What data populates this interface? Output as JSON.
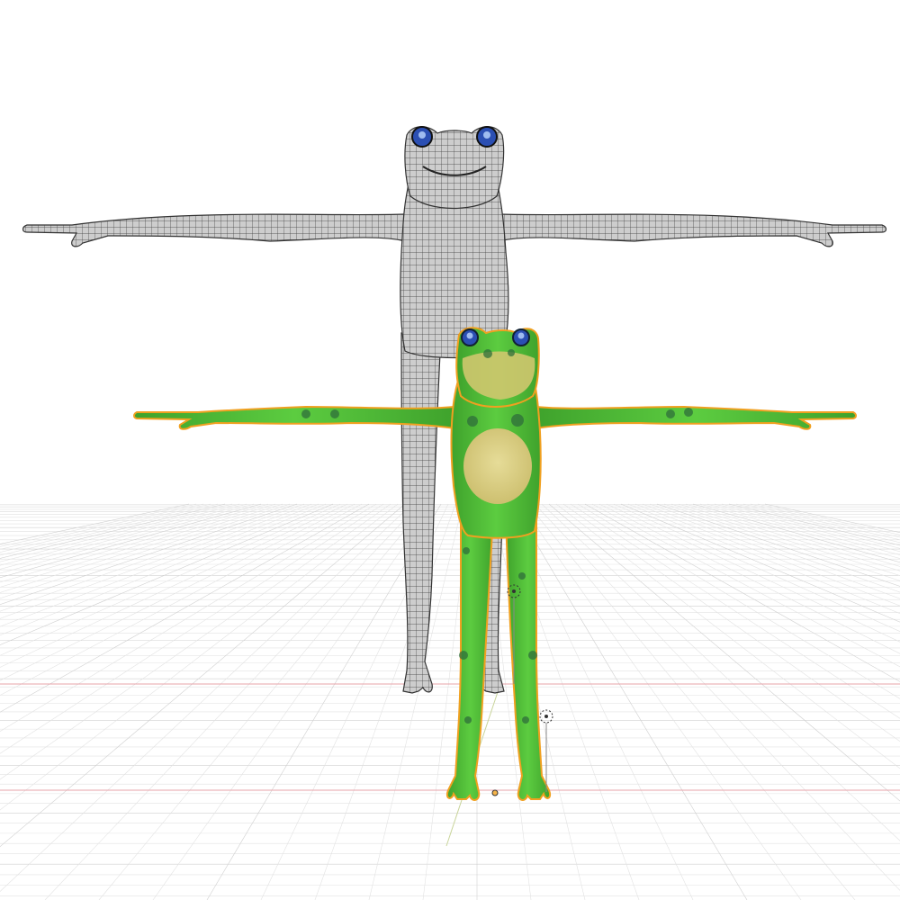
{
  "viewport": {
    "background": "#ffffff",
    "grid_color": "#e2e2e2",
    "grid_major_color": "#d0d0d0",
    "x_axis_color": "#e7a3aa",
    "y_axis_color": "#c9d49a"
  },
  "objects": [
    {
      "name": "frog-wireframe",
      "display": "wireframe",
      "base_color": "#c9c9c9",
      "wire_color": "#3c3c3c",
      "eye_color": "#2b4fb3",
      "selected": false
    },
    {
      "name": "frog-textured",
      "display": "solid-textured",
      "body_color": "#4cbc36",
      "belly_color": "#d9cd84",
      "spot_color": "#2f6e3b",
      "outline_color": "#f0a020",
      "eye_color": "#2b4fb3",
      "selected": true
    }
  ],
  "helpers": [
    {
      "name": "light-empty-1",
      "icon": "light-icon"
    },
    {
      "name": "light-empty-2",
      "icon": "light-icon"
    },
    {
      "name": "object-origin",
      "icon": "origin-icon"
    }
  ]
}
